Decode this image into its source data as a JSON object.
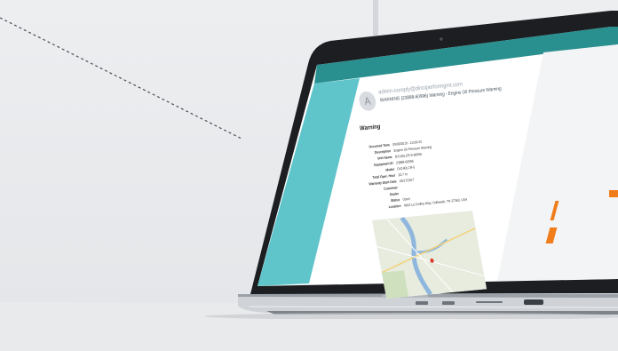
{
  "email": {
    "avatar_letter": "A",
    "from": "admin-noreply@dinolperformgmt.com",
    "subject": "WARNING (23888-60996) Warning - Engine Oil Pressure Warning",
    "heading": "Warning",
    "fields": [
      {
        "key": "Occurred Time",
        "value": "09/09/2019 - 10:09:43"
      },
      {
        "key": "Description",
        "value": "Engine Oil Pressure Warning"
      },
      {
        "key": "Unit Name",
        "value": "DX140LCR-5-60996"
      },
      {
        "key": "Equipment ID",
        "value": "23888-60996"
      },
      {
        "key": "Model",
        "value": "DX140LCR-5"
      },
      {
        "key": "Total Oper. Hour",
        "value": "20.7 hr"
      },
      {
        "key": "Warranty Start Date",
        "value": "09/17/2017"
      },
      {
        "key": "Customer",
        "value": ""
      },
      {
        "key": "Dealer",
        "value": ""
      },
      {
        "key": "Status",
        "value": "Open"
      },
      {
        "key": "Location",
        "value": "4812 La Collina Way, Ooltewah, TN 37363, USA"
      }
    ]
  },
  "colors": {
    "teal_bar": "#2a8f8f",
    "teal_side": "#5fc5cb",
    "bezel": "#1c1e21",
    "body_silver": "#cfd3d8",
    "accent_orange": "#f07d1a"
  },
  "icons": {
    "camera": "webcam-icon",
    "map": "map-thumbnail"
  }
}
